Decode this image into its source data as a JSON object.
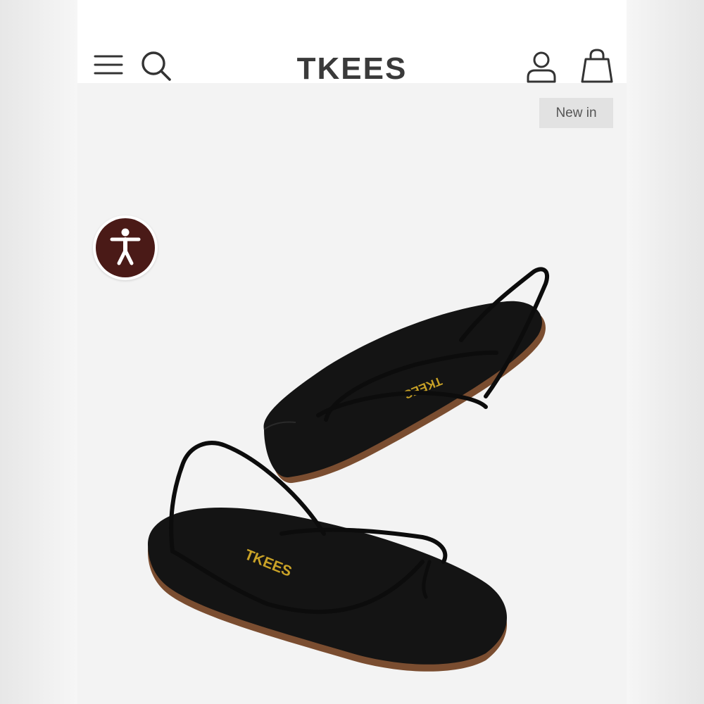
{
  "header": {
    "logo_text": "TKEES",
    "icons": {
      "menu": "hamburger-menu-icon",
      "search": "search-icon",
      "account": "user-account-icon",
      "bag": "shopping-bag-icon"
    }
  },
  "product": {
    "badge": "New in",
    "sole_brand": "TKEES"
  },
  "accessibility": {
    "icon": "accessibility-person-icon",
    "color": "#4a1a17"
  },
  "colors": {
    "header_bg": "#ffffff",
    "content_bg": "#f3f3f3",
    "badge_bg": "#e2e2e2",
    "logo_color": "#3a3a3a",
    "sandal_color": "#141414",
    "sole_logo_color": "#c9a227"
  }
}
